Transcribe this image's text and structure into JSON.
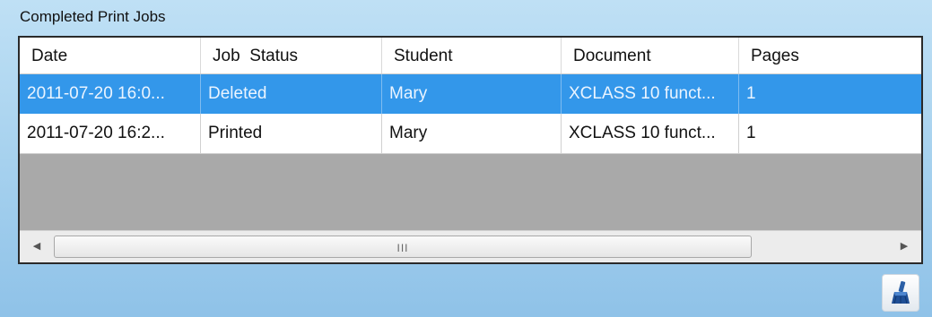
{
  "group": {
    "title": "Completed Print Jobs"
  },
  "grid": {
    "columns": [
      "Date",
      "Job  Status",
      "Student",
      "Document",
      "Pages"
    ],
    "rows": [
      {
        "date": "2011-07-20 16:0...",
        "status": "Deleted",
        "student": "Mary",
        "document": "XCLASS 10 funct...",
        "pages": "1",
        "selected": true
      },
      {
        "date": "2011-07-20 16:2...",
        "status": "Printed",
        "student": "Mary",
        "document": "XCLASS 10 funct...",
        "pages": "1",
        "selected": false
      }
    ]
  },
  "scrollbar": {
    "grip": "III"
  },
  "icons": {
    "clear_button": "broom-icon"
  },
  "colors": {
    "selection": "#3397ea",
    "empty_area": "#a9a9a9",
    "background": "#a9d3ef"
  }
}
